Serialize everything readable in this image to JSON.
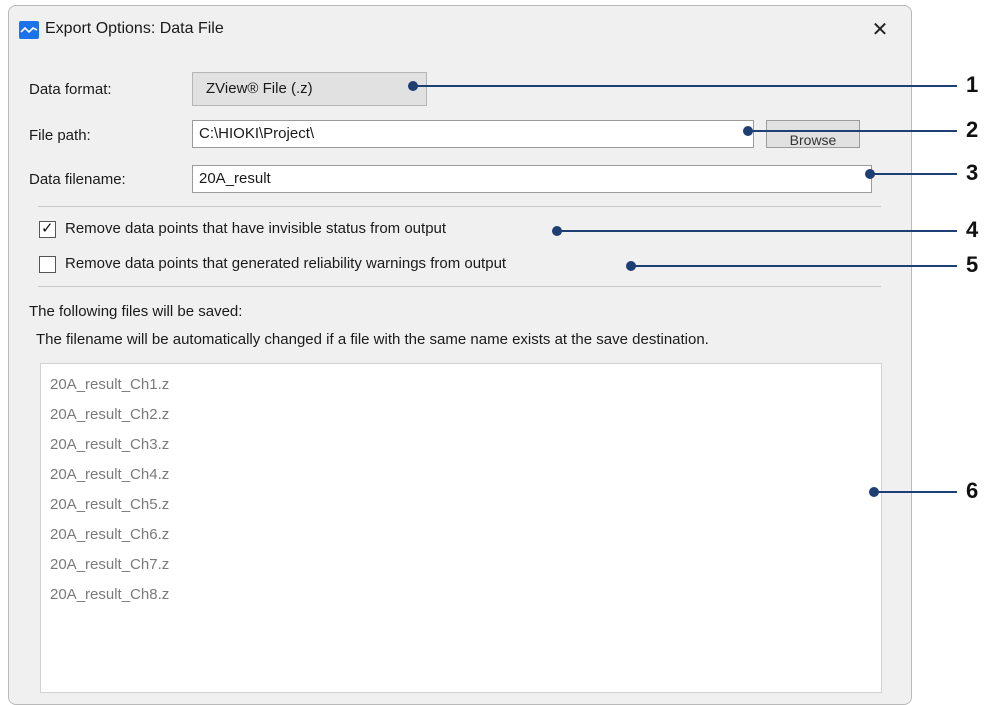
{
  "window": {
    "title": "Export Options: Data File",
    "close_glyph": "✕"
  },
  "form": {
    "data_format_label": "Data format:",
    "data_format_value": "ZView® File (.z)",
    "file_path_label": "File path:",
    "file_path_value": "C:\\HIOKI\\Project\\",
    "browse_label": "Browse",
    "data_filename_label": "Data filename:",
    "data_filename_value": "20A_result"
  },
  "options": {
    "remove_invisible_label": "Remove data points that have invisible status from output",
    "remove_invisible_checked": true,
    "remove_warnings_label": "Remove data points that generated reliability warnings from output",
    "remove_warnings_checked": false
  },
  "output": {
    "heading": "The following files will be saved:",
    "note": "The filename will be automatically changed if a file with the same name exists at the save destination.",
    "files": [
      "20A_result_Ch1.z",
      "20A_result_Ch2.z",
      "20A_result_Ch3.z",
      "20A_result_Ch4.z",
      "20A_result_Ch5.z",
      "20A_result_Ch6.z",
      "20A_result_Ch7.z",
      "20A_result_Ch8.z"
    ]
  },
  "callouts": [
    "1",
    "2",
    "3",
    "4",
    "5",
    "6"
  ],
  "colors": {
    "accent": "#1a73e8",
    "callout": "#1d3f73"
  }
}
